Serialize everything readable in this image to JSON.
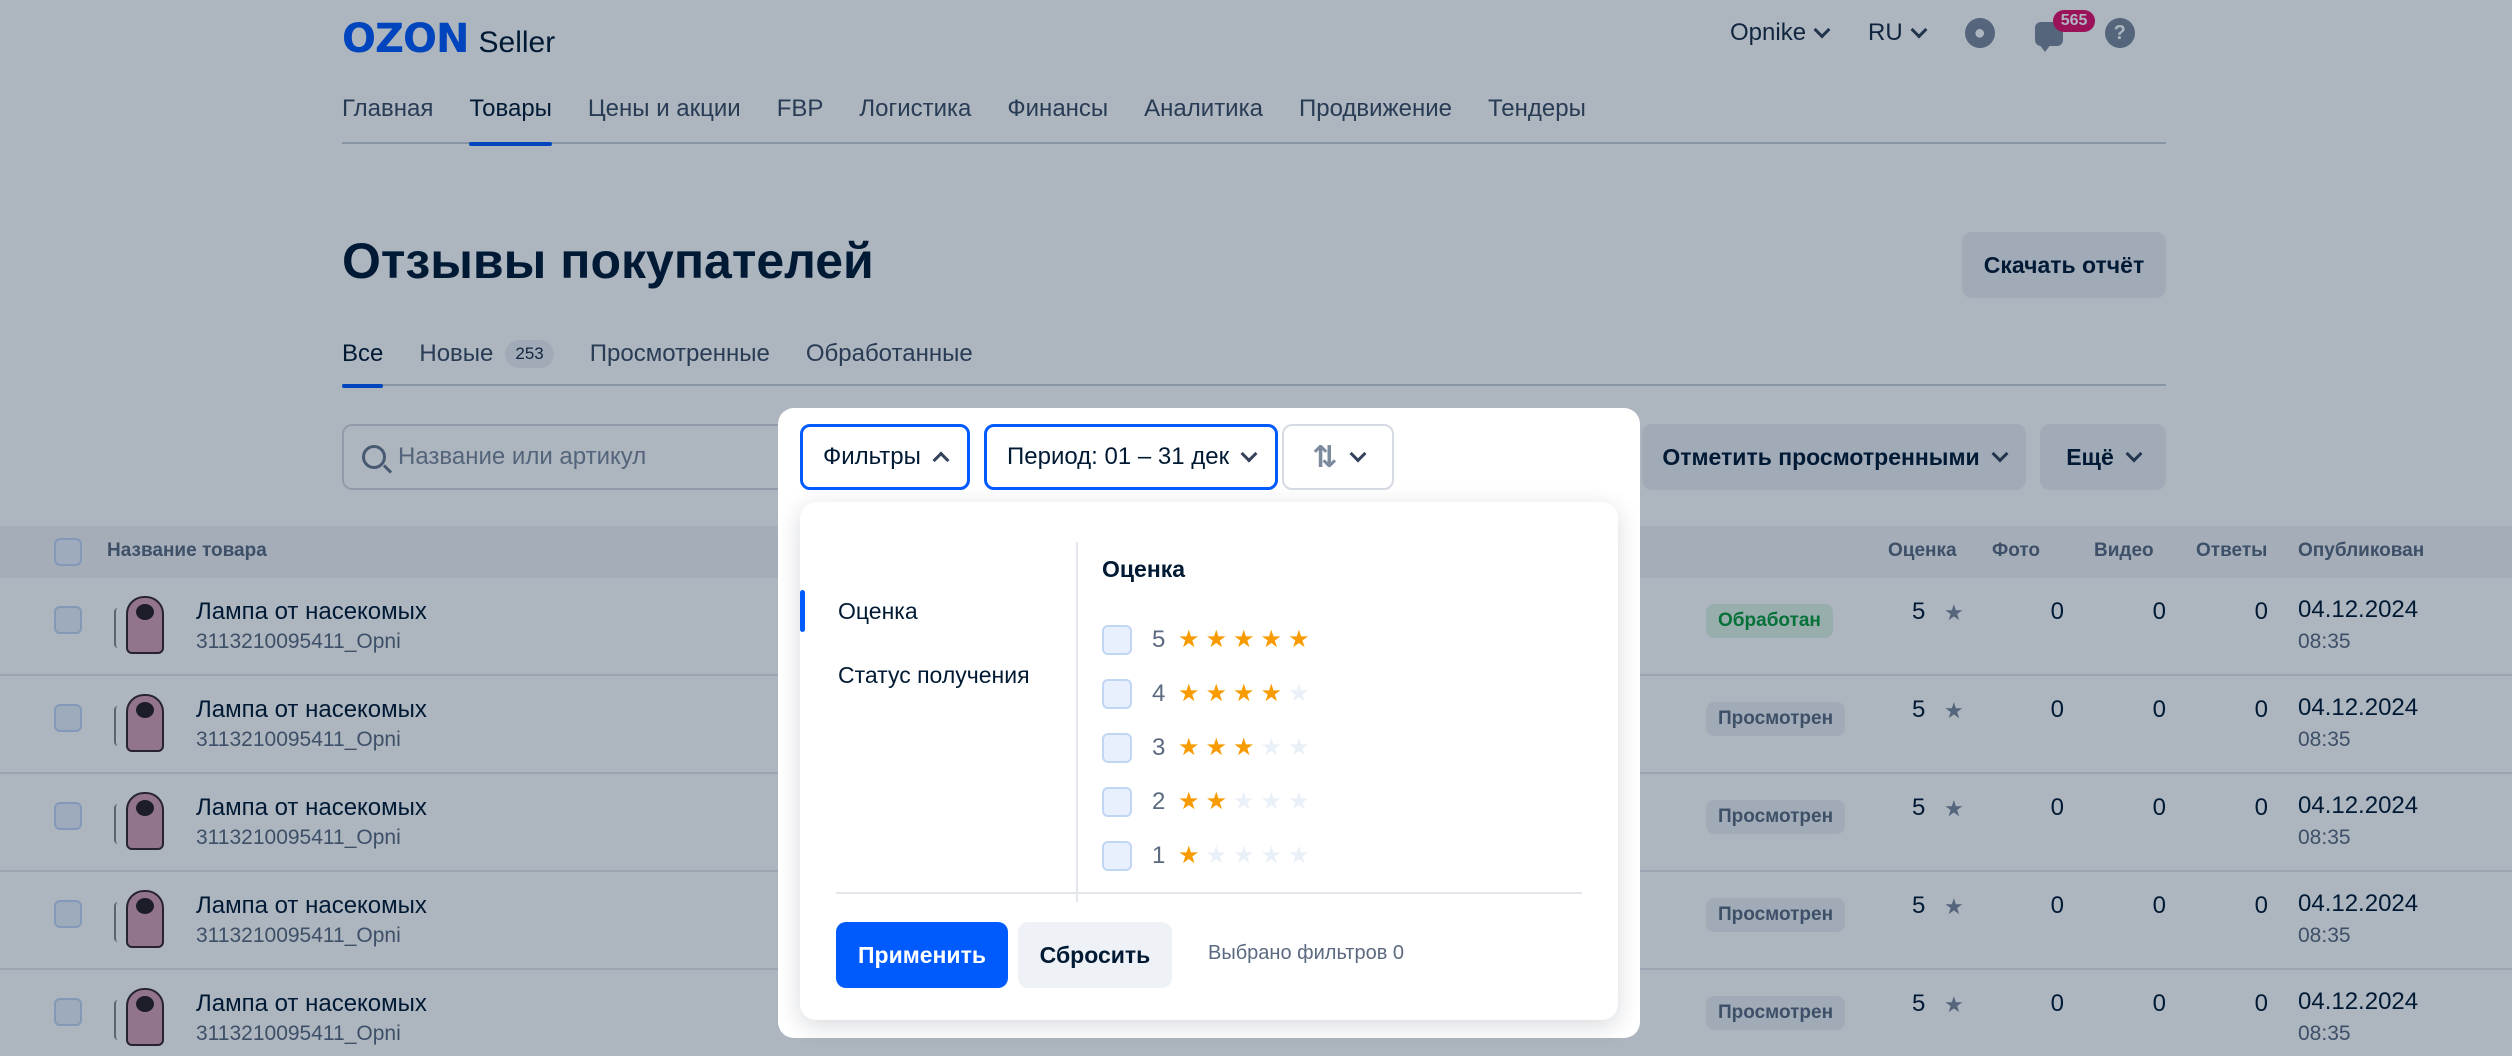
{
  "header": {
    "logo_ozon": "OZON",
    "logo_seller": "Seller",
    "company": "Opnike",
    "language": "RU",
    "notifications_count": "565"
  },
  "nav": [
    "Главная",
    "Товары",
    "Цены и акции",
    "FBP",
    "Логистика",
    "Финансы",
    "Аналитика",
    "Продвижение",
    "Тендеры"
  ],
  "page": {
    "title": "Отзывы покупателей",
    "download_report": "Скачать отчёт"
  },
  "tabs": {
    "all": "Все",
    "new": "Новые",
    "new_count": "253",
    "viewed": "Просмотренные",
    "processed": "Обработанные"
  },
  "toolbar": {
    "search_placeholder": "Название или артикул",
    "mark_viewed": "Отметить просмотренными",
    "more": "Ещё"
  },
  "table": {
    "columns": {
      "name": "Название товара",
      "rating": "Оценка",
      "photo": "Фото",
      "video": "Видео",
      "answers": "Ответы",
      "published": "Опубликован"
    },
    "rows": [
      {
        "name": "Лампа от насекомых",
        "sku": "3113210095411_Opni",
        "status": "Обработан",
        "rating": "5",
        "photo": "0",
        "video": "0",
        "answers": "0",
        "date": "04.12.2024",
        "time": "08:35"
      },
      {
        "name": "Лампа от насекомых",
        "sku": "3113210095411_Opni",
        "status": "Просмотрен",
        "rating": "5",
        "photo": "0",
        "video": "0",
        "answers": "0",
        "date": "04.12.2024",
        "time": "08:35"
      },
      {
        "name": "Лампа от насекомых",
        "sku": "3113210095411_Opni",
        "status": "Просмотрен",
        "rating": "5",
        "photo": "0",
        "video": "0",
        "answers": "0",
        "date": "04.12.2024",
        "time": "08:35"
      },
      {
        "name": "Лампа от насекомых",
        "sku": "3113210095411_Opni",
        "status": "Просмотрен",
        "rating": "5",
        "photo": "0",
        "video": "0",
        "answers": "0",
        "date": "04.12.2024",
        "time": "08:35"
      },
      {
        "name": "Лампа от насекомых",
        "sku": "3113210095411_Opni",
        "status": "Просмотрен",
        "rating": "5",
        "photo": "0",
        "video": "0",
        "answers": "0",
        "date": "04.12.2024",
        "time": "08:35"
      }
    ]
  },
  "filter_popup": {
    "filters_button": "Фильтры",
    "period_button": "Период: 01 – 31 дек",
    "sidebar": [
      "Оценка",
      "Статус получения"
    ],
    "section_title": "Оценка",
    "rating_options": [
      {
        "value": "5",
        "stars": 5
      },
      {
        "value": "4",
        "stars": 4
      },
      {
        "value": "3",
        "stars": 3
      },
      {
        "value": "2",
        "stars": 2
      },
      {
        "value": "1",
        "stars": 1
      }
    ],
    "apply": "Применить",
    "reset": "Сбросить",
    "selected_label": "Выбрано фильтров 0"
  },
  "colors": {
    "accent": "#005bff",
    "star": "#f89b00",
    "badge": "#e3106b",
    "processed": "#0a9b3c"
  }
}
